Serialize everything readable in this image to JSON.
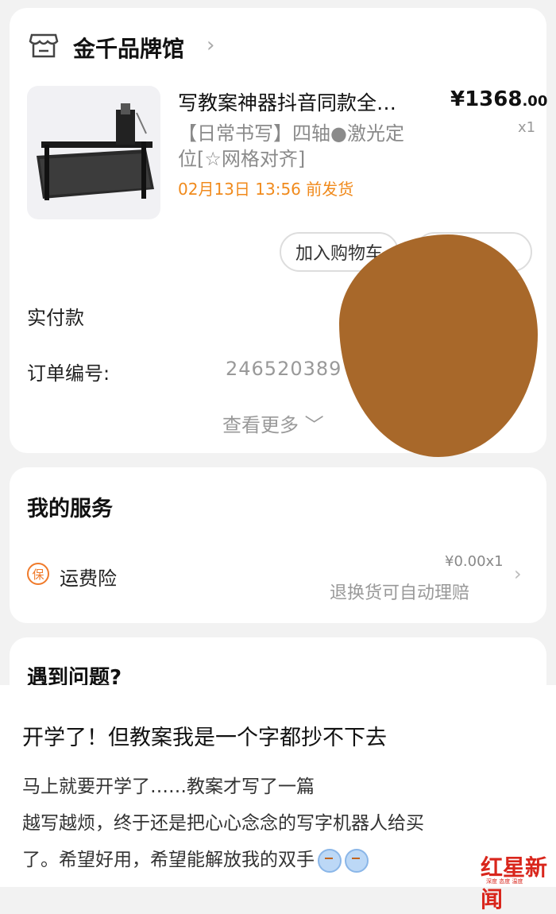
{
  "store": {
    "name": "金千品牌馆",
    "chevron": "›"
  },
  "product": {
    "title": "写教案神器抖音同款全…",
    "price_currency": "¥",
    "price_main": "1368",
    "price_decimal": ".00",
    "quantity": "x1",
    "spec": "【日常书写】四轴●激光定位[☆网格对齐]",
    "ship_time": "02月13日 13:56 前发货"
  },
  "buttons": {
    "add_to_cart": "加入购物车"
  },
  "order": {
    "paid_label": "实付款",
    "order_number_label": "订单编号:",
    "order_number": "246520389",
    "view_more": "查看更多 ﹀"
  },
  "services": {
    "title": "我的服务",
    "badge": "保",
    "item_name": "运费险",
    "item_price": "¥0.00x1",
    "item_desc": "退换货可自动理赔",
    "chevron": "›"
  },
  "issues": {
    "title": "遇到问题?"
  },
  "post": {
    "title": "开学了！但教案我是一个字都抄不下去",
    "line1": "马上就要开学了……教案才写了一篇",
    "line2": "越写越烦，终于还是把心心念念的写字机器人给买",
    "line3": "了。希望好用，希望能解放我的双手"
  },
  "watermark": {
    "name": "红星新闻",
    "sub": "深度 态度 温度"
  },
  "colors": {
    "accent_orange": "#f08a1c",
    "redaction": "#a8682a",
    "watermark_red": "#d9261c"
  }
}
